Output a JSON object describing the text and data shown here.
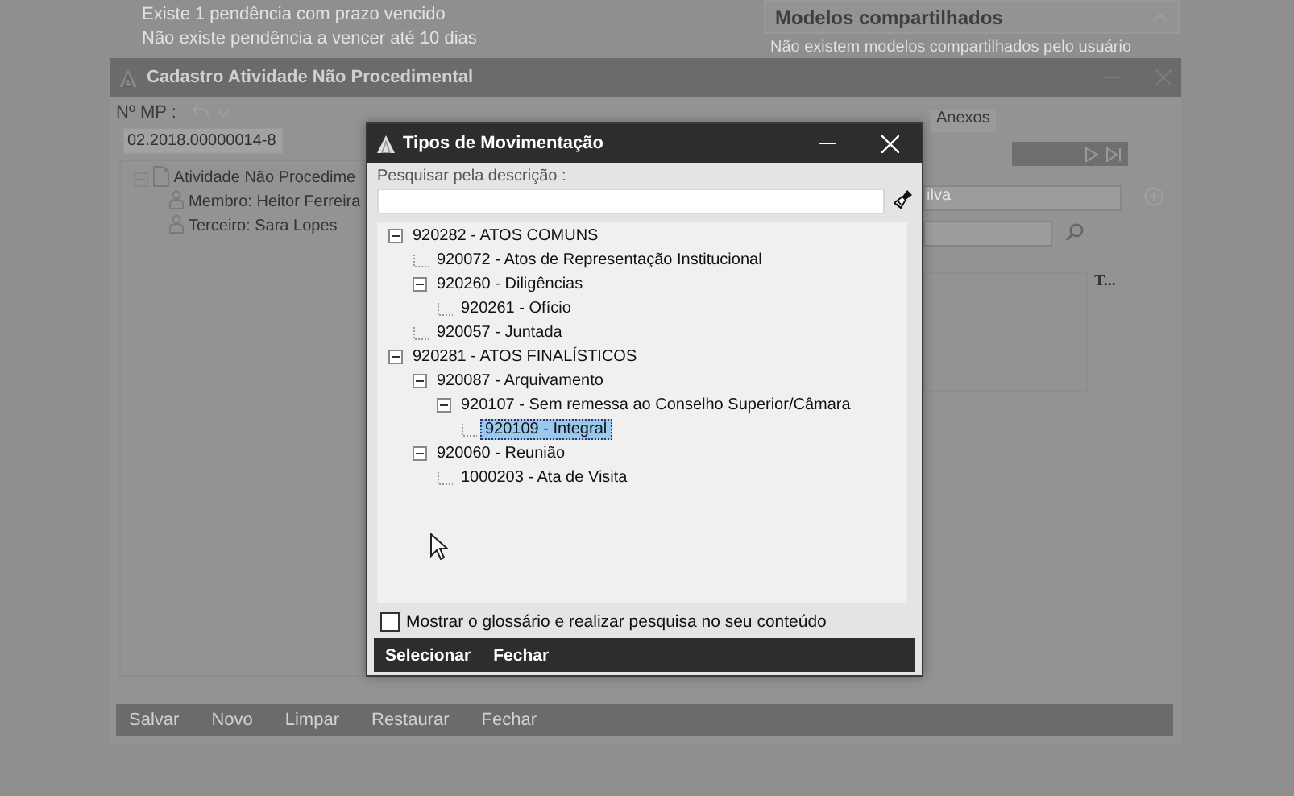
{
  "notices": [
    "Existe 1 pendência com prazo vencido",
    "Não existe pendência a vencer até 10 dias"
  ],
  "shared_models": {
    "title": "Modelos compartilhados",
    "expanded": true,
    "message": "Não existem modelos compartilhados pelo usuário"
  },
  "record_window": {
    "title": "Cadastro Atividade Não Procedimental",
    "mp_label": "Nº MP :",
    "mp_value": "02.2018.00000014-8",
    "tree": [
      {
        "label": "Atividade Não Procedime",
        "expanded": true,
        "children": [
          {
            "label": "Membro: Heitor Ferreira"
          },
          {
            "label": "Terceiro: Sara Lopes"
          }
        ]
      }
    ],
    "tab": "Anexos",
    "field_value": "ilva",
    "column_3": "T...",
    "buttons": [
      "Salvar",
      "Novo",
      "Limpar",
      "Restaurar",
      "Fechar"
    ]
  },
  "dialog": {
    "title": "Tipos de Movimentação",
    "search_label": "Pesquisar pela descrição :",
    "tree": [
      {
        "label": "920282 - ATOS COMUNS",
        "expanded": true,
        "selected": false,
        "children": [
          {
            "label": "920072 - Atos de Representação Institucional",
            "selected": false
          },
          {
            "label": "920260 - Diligências",
            "expanded": true,
            "selected": false,
            "children": [
              {
                "label": "920261 - Ofício",
                "selected": false
              }
            ]
          },
          {
            "label": "920057 - Juntada",
            "selected": false
          }
        ]
      },
      {
        "label": "920281 - ATOS FINALÍSTICOS",
        "expanded": true,
        "selected": false,
        "children": [
          {
            "label": "920087 - Arquivamento",
            "expanded": true,
            "selected": false,
            "children": [
              {
                "label": "920107 - Sem remessa ao Conselho Superior/Câmara",
                "expanded": true,
                "selected": false,
                "children": [
                  {
                    "label": "920109 - Integral",
                    "selected": true
                  }
                ]
              }
            ]
          },
          {
            "label": "920060 - Reunião",
            "expanded": true,
            "selected": false,
            "children": [
              {
                "label": "1000203 - Ata de Visita",
                "selected": false
              }
            ]
          }
        ]
      }
    ],
    "glossary": {
      "label": "Mostrar o glossário e realizar pesquisa no seu conteúdo",
      "checked": false
    },
    "buttons": [
      "Selecionar",
      "Fechar"
    ]
  }
}
